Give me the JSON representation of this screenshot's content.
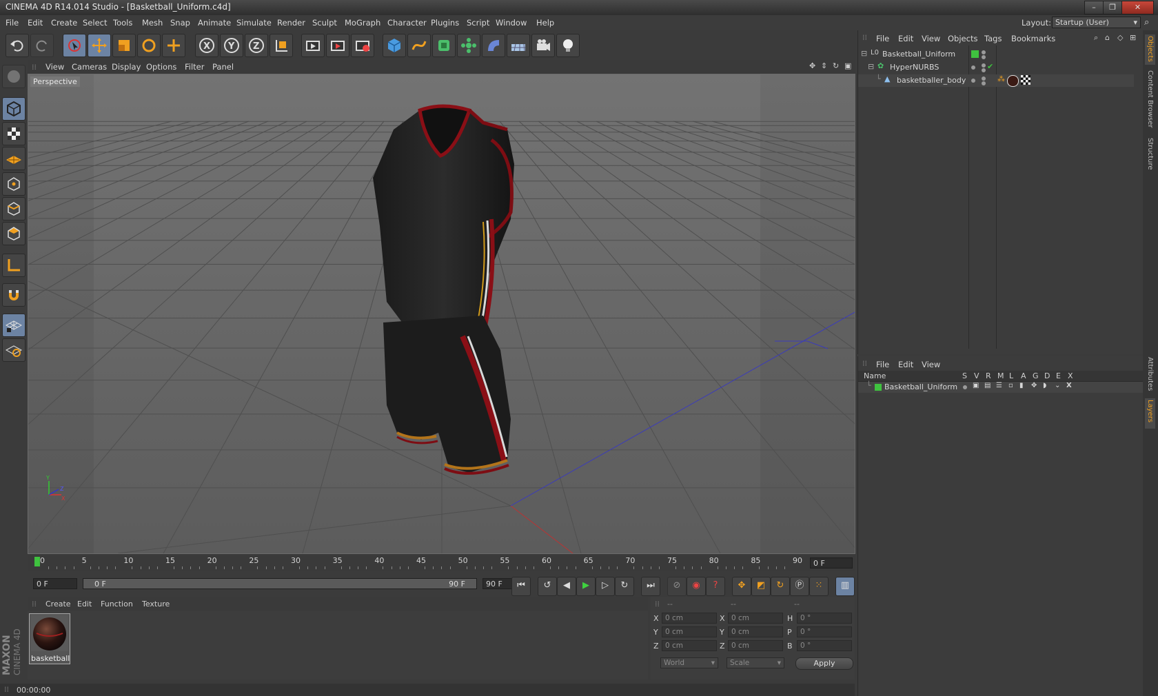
{
  "window": {
    "title": "CINEMA 4D R14.014 Studio - [Basketball_Uniform.c4d]",
    "buttons": [
      "–",
      "❐",
      "✕"
    ]
  },
  "menubar": {
    "items": [
      "File",
      "Edit",
      "Create",
      "Select",
      "Tools",
      "Mesh",
      "Snap",
      "Animate",
      "Simulate",
      "Render",
      "Sculpt",
      "MoGraph",
      "Character",
      "Plugins",
      "Script",
      "Window",
      "Help"
    ],
    "layout_label": "Layout:",
    "layout_value": "Startup (User)"
  },
  "viewport": {
    "menu": [
      "View",
      "Cameras",
      "Display",
      "Options",
      "Filter",
      "Panel"
    ],
    "label": "Perspective"
  },
  "timeline": {
    "ticks": [
      "0",
      "5",
      "10",
      "15",
      "20",
      "25",
      "30",
      "35",
      "40",
      "45",
      "50",
      "55",
      "60",
      "65",
      "70",
      "75",
      "80",
      "85",
      "90"
    ],
    "current_frame": "0 F",
    "start_field": "0 F",
    "range_start": "0 F",
    "range_end": "90 F",
    "end_field": "90 F"
  },
  "material_manager": {
    "menu": [
      "Create",
      "Edit",
      "Function",
      "Texture"
    ],
    "materials": [
      {
        "name": "basketballe"
      }
    ]
  },
  "coordinates": {
    "headers": [
      "--",
      "--",
      "--"
    ],
    "rows": [
      {
        "a": "X",
        "av": "0 cm",
        "b": "X",
        "bv": "0 cm",
        "c": "H",
        "cv": "0 °"
      },
      {
        "a": "Y",
        "av": "0 cm",
        "b": "Y",
        "bv": "0 cm",
        "c": "P",
        "cv": "0 °"
      },
      {
        "a": "Z",
        "av": "0 cm",
        "b": "Z",
        "bv": "0 cm",
        "c": "B",
        "cv": "0 °"
      }
    ],
    "mode1": "World",
    "mode2": "Scale",
    "apply": "Apply"
  },
  "status": {
    "time": "00:00:00"
  },
  "object_manager": {
    "menu": [
      "File",
      "Edit",
      "View",
      "Objects",
      "Tags",
      "Bookmarks"
    ],
    "objects": [
      "Basketball_Uniform",
      "HyperNURBS",
      "basketballer_body"
    ]
  },
  "layer_manager": {
    "menu": [
      "File",
      "Edit",
      "View"
    ],
    "columns": [
      "Name",
      "S",
      "V",
      "R",
      "M",
      "L",
      "A",
      "G",
      "D",
      "E",
      "X"
    ],
    "layers": [
      "Basketball_Uniform"
    ]
  },
  "side_tabs": {
    "top": [
      "Objects",
      "Content Browser",
      "Structure"
    ],
    "bottom": [
      "Attributes",
      "Layers"
    ]
  },
  "logo": {
    "line1": "MAXON",
    "line2": "CINEMA 4D"
  },
  "colors": {
    "selected": "#6c83a3",
    "layer_green": "#3fc23f",
    "accent_orange": "#f0a020"
  }
}
